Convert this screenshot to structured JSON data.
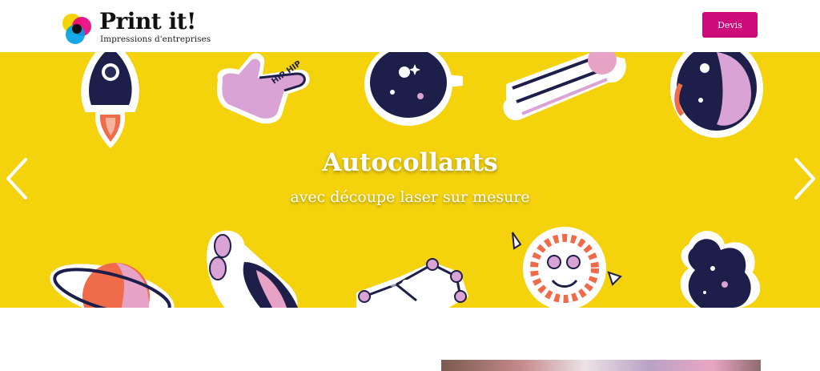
{
  "brand": {
    "name": "Print it!",
    "tagline": "Impressions d'entreprises"
  },
  "header": {
    "cta_label": "Devis"
  },
  "carousel": {
    "title": "Autocollants",
    "subtitle": "avec découpe laser sur mesure",
    "background_color": "#f4d20c",
    "slides_count": 3,
    "active_slide": 2,
    "prev_icon": "chevron-left-icon",
    "next_icon": "chevron-right-icon",
    "sticker_text": "HIP HIP"
  },
  "colors": {
    "accent": "#cc0a7a",
    "hero": "#f4d20c"
  }
}
